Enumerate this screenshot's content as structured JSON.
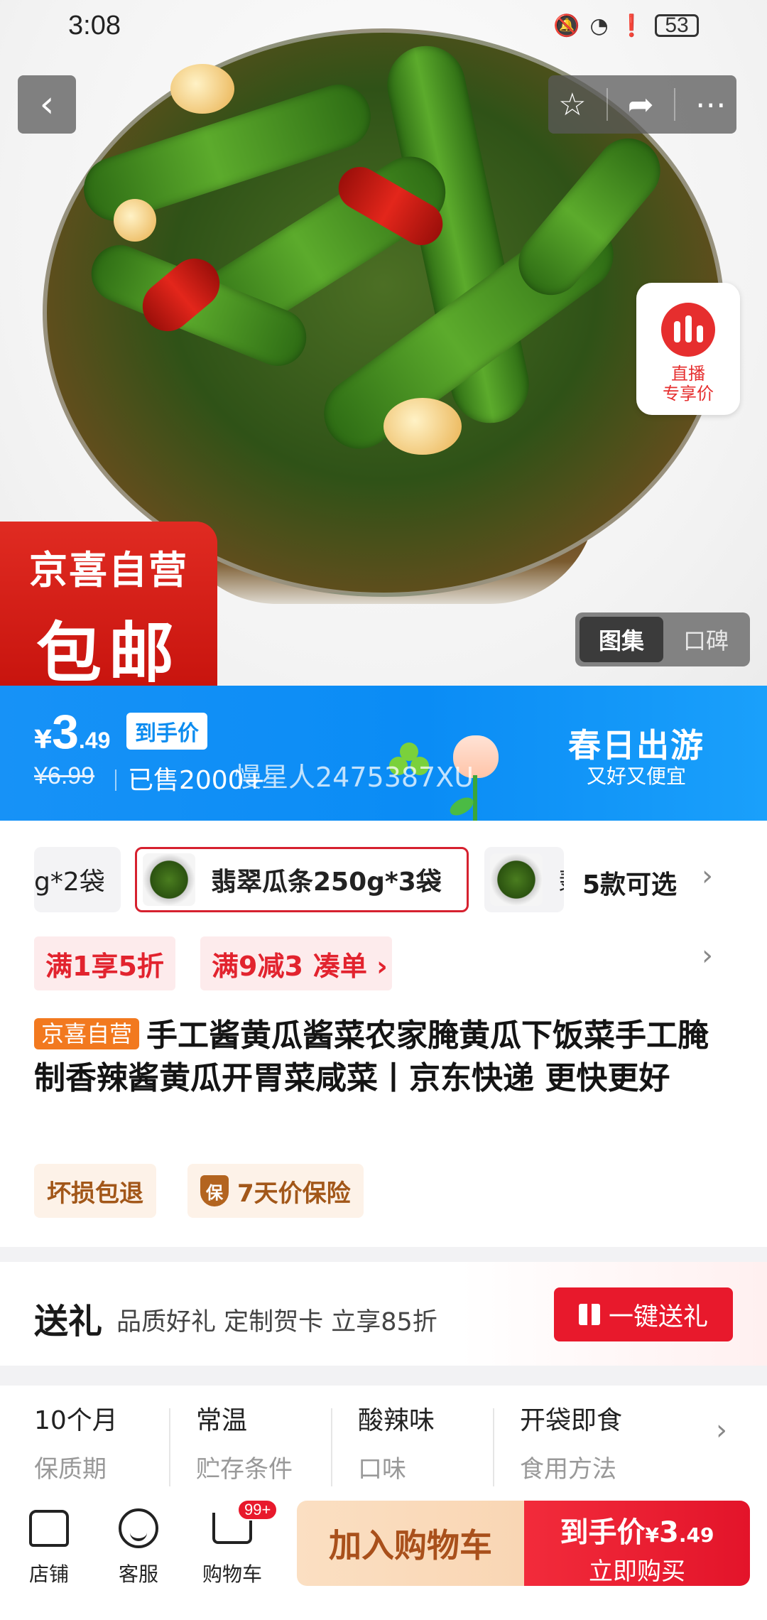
{
  "status_bar": {
    "time": "3:08",
    "battery": "53"
  },
  "hero": {
    "live_label": "直播\n专享价",
    "badge_line1": "京喜自营",
    "badge_line2": "包邮",
    "gallery_tabs": [
      "图集",
      "口碑"
    ]
  },
  "price": {
    "currency": "¥",
    "integer": "3",
    "decimal": ".49",
    "tag": "到手价",
    "original": "¥6.99",
    "sold": "已售2000+",
    "watermark": "慢星人2475387XU",
    "campaign_title": "春日出游",
    "campaign_sub": "又好又便宜"
  },
  "sku": {
    "options": [
      "g*2袋",
      "翡翠瓜条250g*3袋",
      "翡"
    ],
    "count": "5款可选"
  },
  "promos": [
    "满1享5折",
    "满9减3",
    "凑单 ›"
  ],
  "product": {
    "badge": "京喜自营",
    "title": "手工酱黄瓜酱菜农家腌黄瓜下饭菜手工腌制香辣酱黄瓜开胃菜咸菜丨京东快递 更快更好",
    "services": [
      "坏损包退",
      "7天价保险"
    ],
    "shield_char": "保"
  },
  "gift": {
    "title": "送礼",
    "subtitle": "品质好礼 定制贺卡 立享85折",
    "button": "一键送礼"
  },
  "attributes": [
    {
      "value": "10个月",
      "key": "保质期"
    },
    {
      "value": "常温",
      "key": "贮存条件"
    },
    {
      "value": "酸辣味",
      "key": "口味"
    },
    {
      "value": "开袋即食",
      "key": "食用方法"
    }
  ],
  "bottom_bar": {
    "store": "店铺",
    "service": "客服",
    "cart": "购物车",
    "cart_badge": "99+",
    "add_to_cart": "加入购物车",
    "buy_price_label": "到手价",
    "buy_price_currency": "¥",
    "buy_price_int": "3",
    "buy_price_dec": ".49",
    "buy_now": "立即购买"
  },
  "colors": {
    "accent_red": "#e8192c",
    "price_bar_blue": "#0a8cf5",
    "badge_orange": "#f2791f"
  }
}
